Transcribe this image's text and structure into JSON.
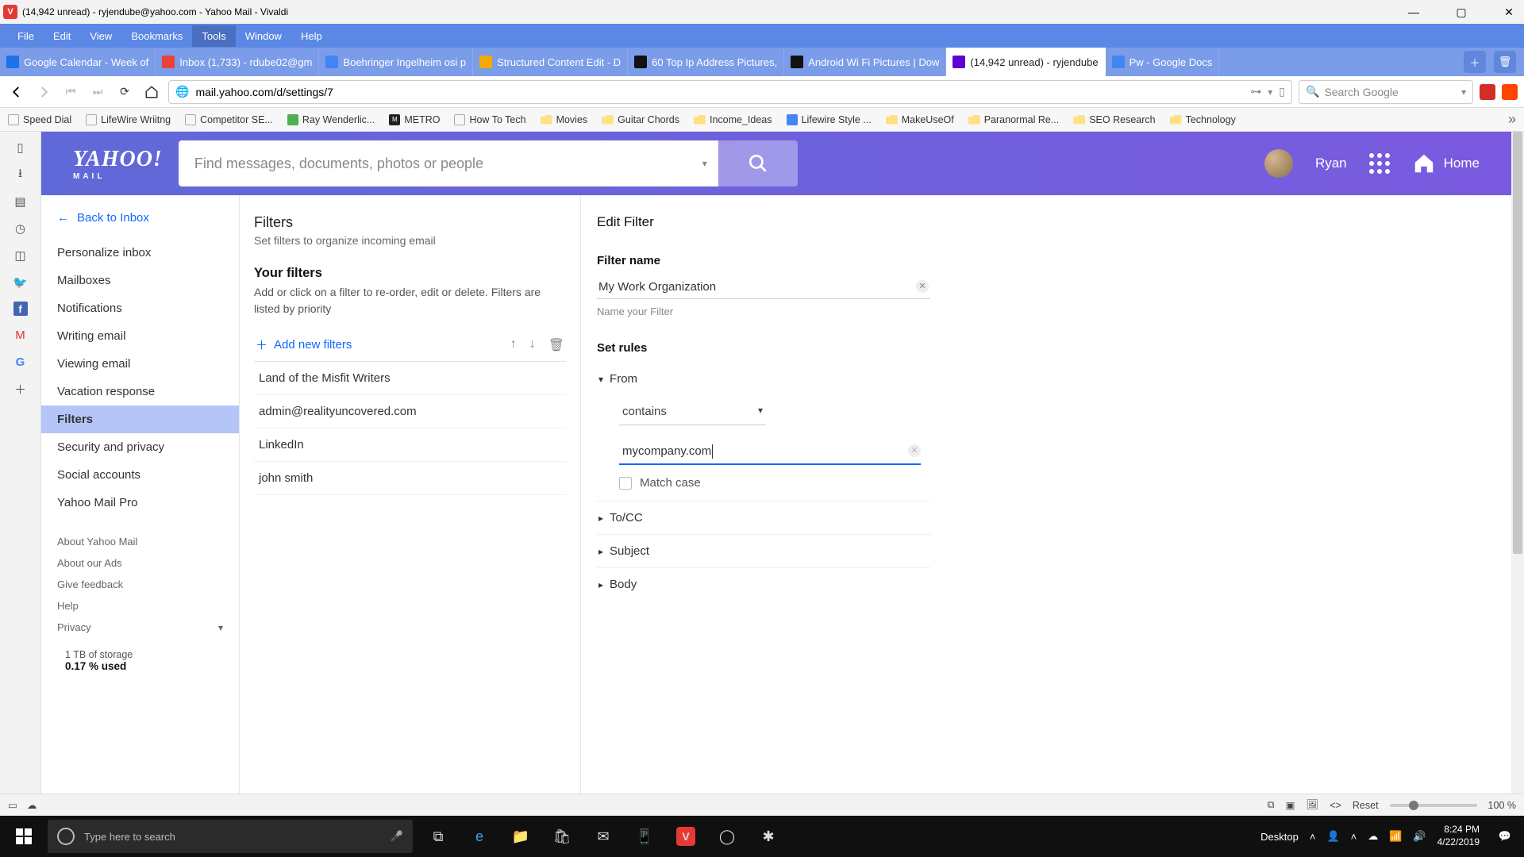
{
  "window": {
    "title": "(14,942 unread) - ryjendube@yahoo.com - Yahoo Mail - Vivaldi"
  },
  "menu": [
    "File",
    "Edit",
    "View",
    "Bookmarks",
    "Tools",
    "Window",
    "Help"
  ],
  "menu_active_index": 4,
  "tabs": [
    {
      "label": "Google Calendar - Week of",
      "favicon": "#1a73e8"
    },
    {
      "label": "Inbox (1,733) - rdube02@gm",
      "favicon": "#ea4335"
    },
    {
      "label": "Boehringer Ingelheim osi p",
      "favicon": "#4285f4"
    },
    {
      "label": "Structured Content Edit - D",
      "favicon": "#f2a900"
    },
    {
      "label": "60 Top Ip Address Pictures,",
      "favicon": "#111"
    },
    {
      "label": "Android Wi Fi Pictures | Dow",
      "favicon": "#111"
    },
    {
      "label": "(14,942 unread) - ryjendube",
      "favicon": "#5f01d1",
      "active": true
    },
    {
      "label": "Pw - Google Docs",
      "favicon": "#4285f4"
    }
  ],
  "url": "mail.yahoo.com/d/settings/7",
  "search_placeholder": "Search Google",
  "bookmarks": [
    "Speed Dial",
    "LifeWire Wriitng",
    "Competitor SE...",
    "Ray Wenderlic...",
    "METRO",
    "How To Tech",
    "Movies",
    "Guitar Chords",
    "Income_Ideas",
    "Lifewire Style ...",
    "MakeUseOf",
    "Paranormal Re...",
    "SEO Research",
    "Technology"
  ],
  "bookmark_is_folder": [
    false,
    false,
    false,
    false,
    false,
    false,
    true,
    true,
    true,
    false,
    true,
    true,
    true,
    true
  ],
  "yahoo": {
    "logo_main": "YAHOO!",
    "logo_sub": "MAIL",
    "search_placeholder": "Find messages, documents, photos or people",
    "user_name": "Ryan",
    "home_label": "Home"
  },
  "settings_nav": {
    "back": "Back to Inbox",
    "items": [
      "Personalize inbox",
      "Mailboxes",
      "Notifications",
      "Writing email",
      "Viewing email",
      "Vacation response",
      "Filters",
      "Security and privacy",
      "Social accounts",
      "Yahoo Mail Pro"
    ],
    "active_index": 6,
    "secondary": [
      "About Yahoo Mail",
      "About our Ads",
      "Give feedback",
      "Help",
      "Privacy"
    ],
    "storage_line1": "1 TB of storage",
    "storage_line2": "0.17 % used"
  },
  "filters": {
    "title": "Filters",
    "subtitle": "Set filters to organize incoming email",
    "your_title": "Your filters",
    "your_sub": "Add or click on a filter to re-order, edit or delete. Filters are listed by priority",
    "add_label": "Add new filters",
    "list": [
      "Land of the Misfit Writers",
      "admin@realityuncovered.com",
      "LinkedIn",
      "john smith"
    ]
  },
  "edit": {
    "title": "Edit Filter",
    "name_label": "Filter name",
    "name_value": "My Work Organization",
    "name_hint": "Name your Filter",
    "rules_label": "Set rules",
    "sections": {
      "from": "From",
      "tocc": "To/CC",
      "subject": "Subject",
      "body": "Body"
    },
    "condition": "contains",
    "value": "mycompany.com",
    "match_case": "Match case"
  },
  "status": {
    "reset": "Reset",
    "zoom": "100 %"
  },
  "taskbar": {
    "search_placeholder": "Type here to search",
    "desktop": "Desktop",
    "time": "8:24 PM",
    "date": "4/22/2019"
  }
}
